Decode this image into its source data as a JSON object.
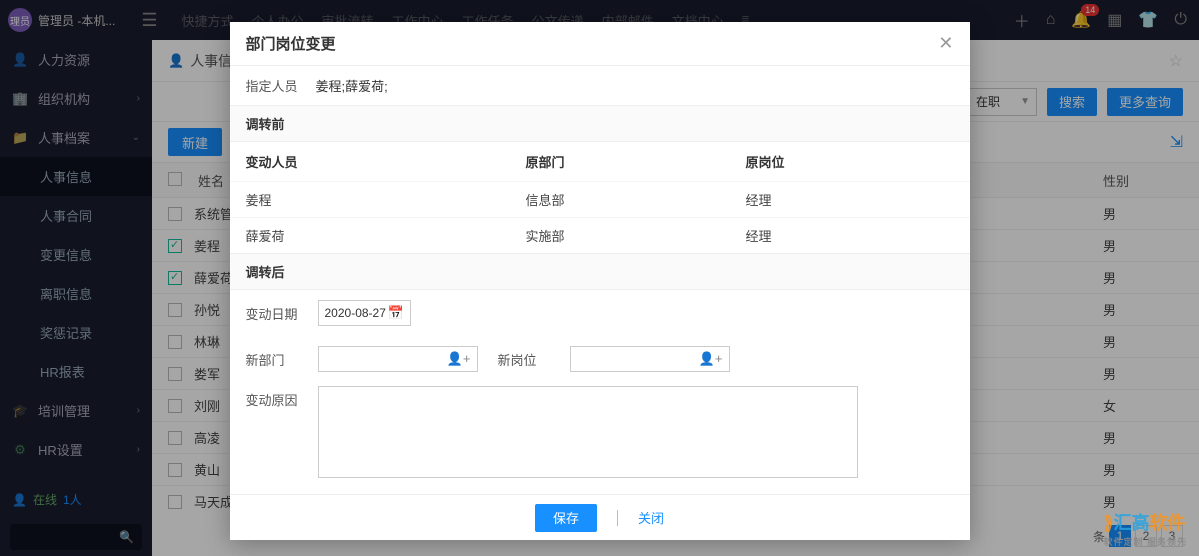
{
  "topbar": {
    "avatar_text": "理员",
    "user": "管理员 -本机...",
    "nav": [
      "快捷方式",
      "个人办公",
      "审批流转",
      "工作中心",
      "工作任务",
      "公文传递",
      "内部邮件",
      "文档中心"
    ],
    "badge_count": "14"
  },
  "sidebar": {
    "items": [
      {
        "icon": "👤",
        "label": "人力资源",
        "chev": ""
      },
      {
        "icon": "🏢",
        "label": "组织机构",
        "chev": "›"
      },
      {
        "icon": "📁",
        "label": "人事档案",
        "chev": "⌄",
        "active": false
      },
      {
        "icon": "",
        "label": "人事信息",
        "sub": true,
        "active": true
      },
      {
        "icon": "",
        "label": "人事合同",
        "sub": true
      },
      {
        "icon": "",
        "label": "变更信息",
        "sub": true
      },
      {
        "icon": "",
        "label": "离职信息",
        "sub": true
      },
      {
        "icon": "",
        "label": "奖惩记录",
        "sub": true
      },
      {
        "icon": "",
        "label": "HR报表",
        "sub": true
      },
      {
        "icon": "🎓",
        "label": "培训管理",
        "chev": "›"
      },
      {
        "icon": "⚙",
        "label": "HR设置",
        "chev": "›"
      }
    ],
    "online_label": "在线",
    "online_count": "1人",
    "search_placeholder": ""
  },
  "breadcrumb": {
    "text": "人事信"
  },
  "filter": {
    "status": "在职",
    "search_btn": "搜索",
    "more_btn": "更多查询"
  },
  "toolbar": {
    "new_btn": "新建"
  },
  "table": {
    "head_name": "姓名",
    "head_gender": "性别",
    "rows": [
      {
        "name": "系统管",
        "gender": "男",
        "checked": false
      },
      {
        "name": "姜程",
        "gender": "男",
        "checked": true
      },
      {
        "name": "薛爱荷",
        "gender": "男",
        "checked": true
      },
      {
        "name": "孙悦",
        "gender": "男",
        "checked": false
      },
      {
        "name": "林琳",
        "gender": "男",
        "checked": false
      },
      {
        "name": "娄军",
        "gender": "男",
        "checked": false
      },
      {
        "name": "刘刚",
        "gender": "女",
        "checked": false
      },
      {
        "name": "高凌",
        "gender": "男",
        "checked": false
      },
      {
        "name": "黄山",
        "gender": "男",
        "checked": false
      },
      {
        "name": "马天成",
        "gender": "男",
        "checked": false
      }
    ]
  },
  "pager": {
    "suffix": "条",
    "pages": [
      "1",
      "2",
      "3"
    ]
  },
  "modal": {
    "title": "部门岗位变更",
    "assign_label": "指定人员",
    "assign_value": "姜程;薛爱荷;",
    "before_section": "调转前",
    "th_person": "变动人员",
    "th_dept": "原部门",
    "th_pos": "原岗位",
    "rows": [
      {
        "person": "姜程",
        "dept": "信息部",
        "pos": "经理"
      },
      {
        "person": "薛爱荷",
        "dept": "实施部",
        "pos": "经理"
      }
    ],
    "after_section": "调转后",
    "date_label": "变动日期",
    "date_value": "2020-08-27",
    "new_dept_label": "新部门",
    "new_pos_label": "新岗位",
    "reason_label": "变动原因",
    "save_btn": "保存",
    "close_btn": "关闭"
  },
  "watermark": {
    "text1": "汇高",
    "text2": "软件",
    "sub": "软件定制 服务领先"
  }
}
